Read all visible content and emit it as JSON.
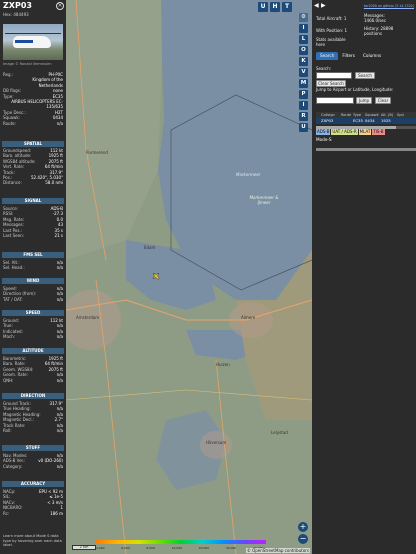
{
  "aircraft": {
    "callsign": "ZXP03",
    "hex_line": "Hex:  484493",
    "photo_credit": "Image © Ronald Vermeulen"
  },
  "info": [
    {
      "k": "Reg.:",
      "v": "PH-PXC"
    },
    {
      "k": "",
      "v": "Kingdom of the"
    },
    {
      "k": "",
      "v": "Netherlands"
    },
    {
      "k": "DB flags:",
      "v": "none"
    },
    {
      "k": "Type:",
      "v": "EC35"
    },
    {
      "k": "",
      "v": "AIRBUS HELICOPTERS EC-"
    },
    {
      "k": "",
      "v": "135/635"
    },
    {
      "k": "Type Desc.:",
      "v": "H2T"
    },
    {
      "k": "Squawk:",
      "v": "0434"
    },
    {
      "k": "Route:",
      "v": "n/a"
    }
  ],
  "sections": {
    "spatial": "SPATIAL",
    "signal": "SIGNAL",
    "fms_sel": "FMS SEL",
    "wind": "WIND",
    "speed": "SPEED",
    "altitude": "ALTITUDE",
    "direction": "DIRECTION",
    "stuff": "STUFF",
    "accuracy": "ACCURACY"
  },
  "spatial": [
    {
      "k": "Groundspeed:",
      "v": "112 kt"
    },
    {
      "k": "Baro. altitude:",
      "v": "1925 ft"
    },
    {
      "k": "WGS84 altitude:",
      "v": "2075 ft"
    },
    {
      "k": "Vert. Rate:",
      "v": "64 ft/min"
    },
    {
      "k": "Track:",
      "v": "317.9°"
    },
    {
      "k": "Pos.:",
      "v": "52.420°, 5.030°"
    },
    {
      "k": "Distance:",
      "v": "58.0 nmi"
    }
  ],
  "signal": [
    {
      "k": "Source:",
      "v": "ADS-B"
    },
    {
      "k": "RSSI:",
      "v": "-27.3"
    },
    {
      "k": "Msg. Rate:",
      "v": "0.0"
    },
    {
      "k": "Messages:",
      "v": "43"
    },
    {
      "k": "Last Pos.:",
      "v": "35 s"
    },
    {
      "k": "Last Seen:",
      "v": "21 s"
    }
  ],
  "fms_sel": [
    {
      "k": "Sel. Alt.:",
      "v": "n/a"
    },
    {
      "k": "Sel. Head.:",
      "v": "n/a"
    }
  ],
  "wind": [
    {
      "k": "Speed:",
      "v": "n/a"
    },
    {
      "k": "Direction (from):",
      "v": "n/a"
    },
    {
      "k": "TAT / OAT:",
      "v": "n/a"
    }
  ],
  "speed": [
    {
      "k": "Ground:",
      "v": "112 kt"
    },
    {
      "k": "True:",
      "v": "n/a"
    },
    {
      "k": "Indicated:",
      "v": "n/a"
    },
    {
      "k": "Mach:",
      "v": "n/a"
    }
  ],
  "altitude": [
    {
      "k": "Barometric:",
      "v": "1925 ft"
    },
    {
      "k": "Baro. Rate:",
      "v": "64 ft/min"
    },
    {
      "k": "Geom. WGS84:",
      "v": "2075 ft"
    },
    {
      "k": "Geom. Rate:",
      "v": "n/a"
    },
    {
      "k": "QNH:",
      "v": "n/a"
    }
  ],
  "direction": [
    {
      "k": "Ground Track:",
      "v": "317.9°"
    },
    {
      "k": "True Heading:",
      "v": "n/a"
    },
    {
      "k": "Magnetic Heading:",
      "v": "n/a"
    },
    {
      "k": "Magnetic Decl.:",
      "v": "2.7°"
    },
    {
      "k": "Track Rate:",
      "v": "n/a"
    },
    {
      "k": "Roll:",
      "v": "n/a"
    }
  ],
  "stuff": [
    {
      "k": "Nav. Modes:",
      "v": "n/a"
    },
    {
      "k": "ADS-B Ver.:",
      "v": "v0 (DO-260)"
    },
    {
      "k": "Category:",
      "v": "n/a"
    }
  ],
  "accuracy": [
    {
      "k": "NACp:",
      "v": "EPU < 92 m"
    },
    {
      "k": "SIL:",
      "v": "≤ 1e-5"
    },
    {
      "k": "NACv:",
      "v": "< 3 m/s"
    },
    {
      "k": "NICBARO:",
      "v": "1"
    },
    {
      "k": "Rc:",
      "v": "186 m"
    }
  ],
  "footer_note": "Learn more about Mode S data type by hovering over each data label.",
  "map": {
    "labels": {
      "markermeer": "Markermeer",
      "markermeer_sub": "Markermeer & IJmeer",
      "amsterdam": "Amsterdam",
      "almere": "Almere",
      "lelystad": "Lelystad",
      "hilversum": "Hilversum",
      "huizen": "Huizen",
      "purmerend": "Purmerend",
      "edam": "Edam"
    },
    "scale_label": "2 km",
    "legend_ticks": [
      "4,000",
      "6,000",
      "8,000",
      "10,000",
      "20,000",
      "30,000",
      "40,000+"
    ],
    "attribution": "© OpenStreetMap contributors",
    "top_buttons": [
      "U",
      "H",
      "T"
    ],
    "zoom_in": "+",
    "zoom_out": "−"
  },
  "toolbar": [
    "I",
    "L",
    "O",
    "K",
    "V",
    "M",
    "P",
    "I",
    "R",
    "U"
  ],
  "sidebar": {
    "top_link": "tar1090 on github (3.14.1702)",
    "total_aircraft": "Total Aircraft: 1",
    "messages": "Messages:",
    "messages_rate": "1466.0/sec",
    "with_position": "With Position: 1",
    "history": "History: 28898",
    "history_sub": "positions",
    "stats": "Stats available",
    "stats_link": "here",
    "tabs": [
      "Search",
      "Filters",
      "Columns"
    ],
    "search_label": "Search:",
    "search_button": "Search",
    "clear_search": "Clear Search",
    "jump_label": "Jump to Airport or Latitude, Longitude:",
    "jump_button": "Jump",
    "clear_button": "Clear",
    "table_headers": [
      "",
      "Callsign",
      "Route",
      "Type",
      "Squawk",
      "Alt. (ft)",
      "Spd"
    ],
    "table_row": [
      "",
      "ZXP03",
      "",
      "EC35",
      "0434",
      "1925",
      ""
    ],
    "badges": [
      "ADS-B",
      "UAT / ADS-R",
      "MLAT",
      "TIS-B"
    ],
    "modes": "Mode-S"
  },
  "colors": {
    "panel": "#2c2c2c",
    "section": "#3a5f7d",
    "accent": "#2f6fb5",
    "badge_adsb": "#88b0e0",
    "badge_uat": "#cfe08a",
    "badge_mlat": "#f2d38a",
    "badge_tisb": "#f08a8a"
  }
}
